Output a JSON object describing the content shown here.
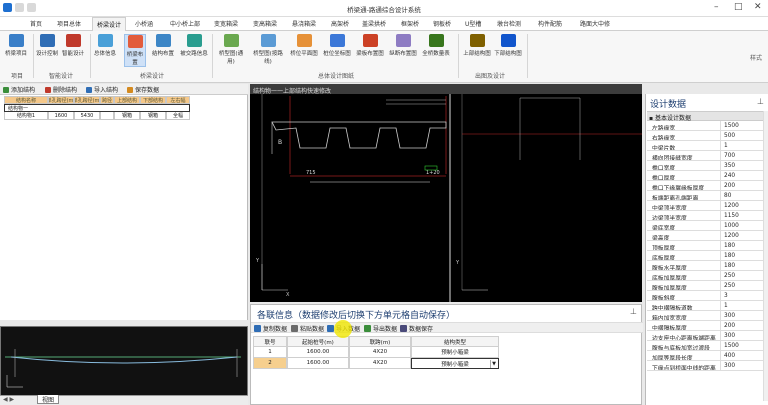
{
  "app": {
    "title": "桥梁通-路通综合设计系统",
    "win_min": "–",
    "win_max": "□",
    "win_close": "✕",
    "options": "样式"
  },
  "tabs": [
    "首页",
    "项目总体",
    "桥梁设计",
    "小桥涵",
    "中小桥上部",
    "变宽箱梁",
    "变高箱梁",
    "悬浇箱梁",
    "高架桥",
    "盖梁拱桥",
    "框架桥",
    "钢板桥",
    "U型槽",
    "墩台检测",
    "构件配筋",
    "路面大中修"
  ],
  "ribbon": {
    "buttons": [
      {
        "label": "桥梁项目",
        "color": "#3a7fc8"
      },
      {
        "label": "设计控制",
        "color": "#2f6db5"
      },
      {
        "label": "智能设计",
        "color": "#c0392b"
      },
      {
        "label": "总体信息",
        "color": "#4aa0d8"
      },
      {
        "label": "桥梁布置",
        "color": "#e25c3c"
      },
      {
        "label": "结构布置",
        "color": "#3d86c6"
      },
      {
        "label": "被交路信息",
        "color": "#2a9d8f"
      },
      {
        "label": "桥型图(通用)",
        "color": "#6aa84f"
      },
      {
        "label": "桥型图(按路线)",
        "color": "#5b9bd5"
      },
      {
        "label": "桥位平面图",
        "color": "#e69138"
      },
      {
        "label": "桩位坐标图",
        "color": "#3c78d8"
      },
      {
        "label": "梁板布置图",
        "color": "#cc4125"
      },
      {
        "label": "纵断布置图",
        "color": "#8e7cc3"
      },
      {
        "label": "全桥数量表",
        "color": "#38761d"
      },
      {
        "label": "上部结构图",
        "color": "#7f6000"
      },
      {
        "label": "下部结构图",
        "color": "#1155cc"
      }
    ],
    "groups": [
      "项目",
      "智能设计",
      "桥梁设计",
      "总体设计图纸",
      "出图及设计"
    ]
  },
  "left_panel": {
    "toolbar": [
      "添加结构",
      "删除结构",
      "导入结构",
      "保存数据"
    ],
    "headers": [
      "结构名称",
      "单孔跨径(m)",
      "单孔跨径(m)",
      "跨径",
      "上部结构",
      "下部结构",
      "左右幅"
    ],
    "rows": [
      [
        "结构物一",
        "",
        "",
        "",
        "",
        "",
        ""
      ],
      [
        "结构物1",
        "1600",
        "5430",
        "",
        "钢箱",
        "钢箱",
        "全幅"
      ]
    ],
    "sheet": "视图"
  },
  "cad": {
    "header": "结构物一一上部结构快速修改"
  },
  "info": {
    "title": "各联信息（数据修改后切换下方单元格自动保存）",
    "toolbar": [
      "复制数据",
      "粘贴数据",
      "导入数据",
      "导出数据",
      "数据保存"
    ],
    "headers": [
      "联号",
      "起始桩号(m)",
      "联跨(m)",
      "结构类型"
    ],
    "rows": [
      [
        "1",
        "1600.00",
        "4X20",
        "预制小箱梁"
      ],
      [
        "2",
        "1600.00",
        "4X20",
        "预制小箱梁"
      ]
    ]
  },
  "design": {
    "title": "设计数据",
    "section": "基本设计数据",
    "rows": [
      [
        "左路缘宽",
        "1500"
      ],
      [
        "右路缘宽",
        "500"
      ],
      [
        "中梁片数",
        "1"
      ],
      [
        "横向团接缝宽度",
        "700"
      ],
      [
        "檐口宽度",
        "350"
      ],
      [
        "檐口厚度",
        "240"
      ],
      [
        "檐口下缘翼缘板厚度",
        "200"
      ],
      [
        "板端距离孔端距离",
        "80"
      ],
      [
        "中梁顶半宽度",
        "1200"
      ],
      [
        "边梁顶半宽度",
        "1150"
      ],
      [
        "梁底宽度",
        "1000"
      ],
      [
        "梁高度",
        "1200"
      ],
      [
        "顶板厚度",
        "180"
      ],
      [
        "底板厚度",
        "180"
      ],
      [
        "腹板水平厚度",
        "180"
      ],
      [
        "底板加厚厚度",
        "250"
      ],
      [
        "腹板加厚厚度",
        "250"
      ],
      [
        "腹板斜度",
        "3"
      ],
      [
        "跨中横隔板道数",
        "1"
      ],
      [
        "箱内加宽宽度",
        "300"
      ],
      [
        "中横隔板厚度",
        "200"
      ],
      [
        "边支座中心距离板端距离",
        "300"
      ],
      [
        "腹板与底板加宽过渡段",
        "1500"
      ],
      [
        "加厚等厚段长度",
        "400"
      ],
      [
        "下缘点到桥面中线的距离",
        "300"
      ]
    ]
  }
}
